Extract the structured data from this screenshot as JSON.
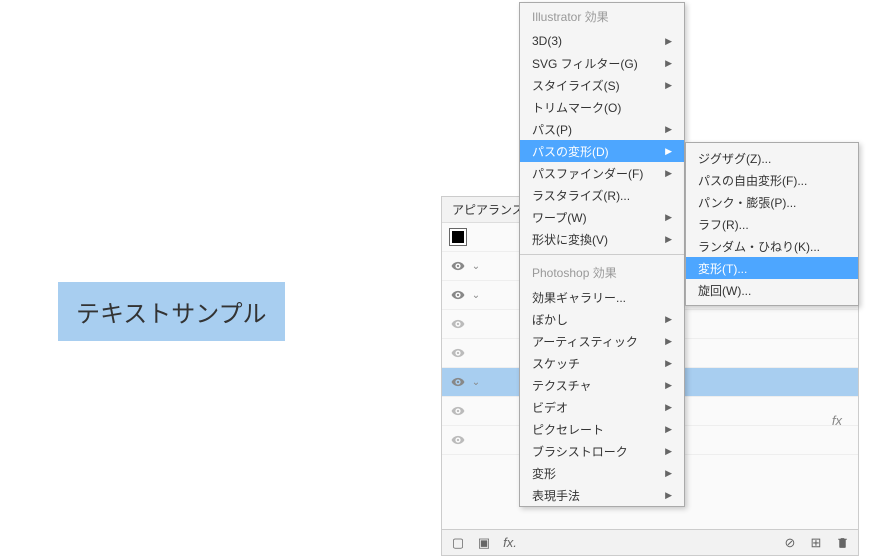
{
  "text_sample": "テキストサンプル",
  "appearance_panel": {
    "tab_label": "アピアランス",
    "fx_badge": "fx",
    "footer_icons": {
      "left": [
        "square-icon",
        "filled-square-icon",
        "fx-icon"
      ],
      "right": [
        "no-icon",
        "add-icon",
        "trash-icon"
      ]
    }
  },
  "effects_menu": {
    "section1_header": "Illustrator 効果",
    "section1_items": [
      {
        "label": "3D(3)",
        "has_submenu": true
      },
      {
        "label": "SVG フィルター(G)",
        "has_submenu": true
      },
      {
        "label": "スタイライズ(S)",
        "has_submenu": true
      },
      {
        "label": "トリムマーク(O)",
        "has_submenu": false
      },
      {
        "label": "パス(P)",
        "has_submenu": true
      },
      {
        "label": "パスの変形(D)",
        "has_submenu": true,
        "highlighted": true
      },
      {
        "label": "パスファインダー(F)",
        "has_submenu": true
      },
      {
        "label": "ラスタライズ(R)...",
        "has_submenu": false
      },
      {
        "label": "ワープ(W)",
        "has_submenu": true
      },
      {
        "label": "形状に変換(V)",
        "has_submenu": true
      }
    ],
    "section2_header": "Photoshop 効果",
    "section2_items": [
      {
        "label": "効果ギャラリー...",
        "has_submenu": false
      },
      {
        "label": "ぼかし",
        "has_submenu": true
      },
      {
        "label": "アーティスティック",
        "has_submenu": true
      },
      {
        "label": "スケッチ",
        "has_submenu": true
      },
      {
        "label": "テクスチャ",
        "has_submenu": true
      },
      {
        "label": "ビデオ",
        "has_submenu": true
      },
      {
        "label": "ピクセレート",
        "has_submenu": true
      },
      {
        "label": "ブラシストローク",
        "has_submenu": true
      },
      {
        "label": "変形",
        "has_submenu": true
      },
      {
        "label": "表現手法",
        "has_submenu": true
      }
    ]
  },
  "submenu": {
    "items": [
      {
        "label": "ジグザグ(Z)...",
        "highlighted": false
      },
      {
        "label": "パスの自由変形(F)...",
        "highlighted": false
      },
      {
        "label": "パンク・膨張(P)...",
        "highlighted": false
      },
      {
        "label": "ラフ(R)...",
        "highlighted": false
      },
      {
        "label": "ランダム・ひねり(K)...",
        "highlighted": false
      },
      {
        "label": "変形(T)...",
        "highlighted": true
      },
      {
        "label": "旋回(W)...",
        "highlighted": false
      }
    ]
  }
}
